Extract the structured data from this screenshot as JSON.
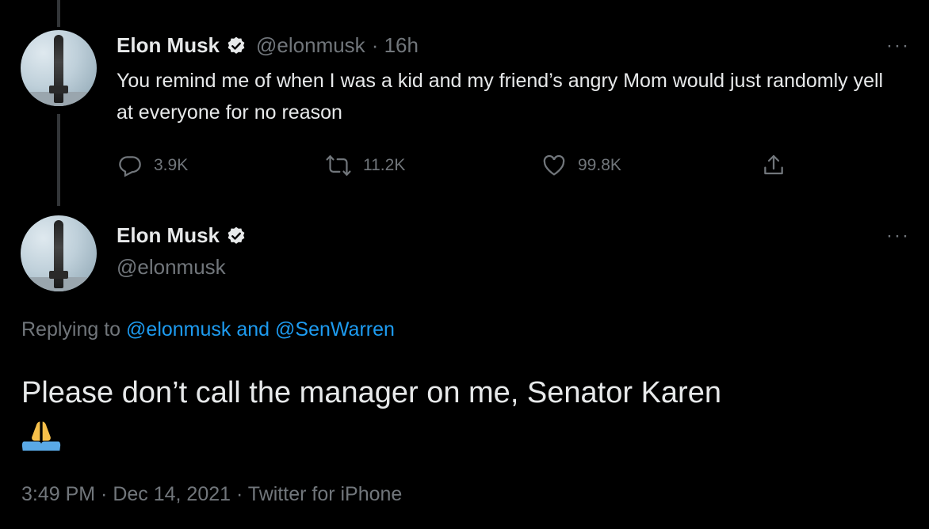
{
  "tweet1": {
    "name": "Elon Musk",
    "handle": "@elonmusk",
    "time": "· 16h",
    "text": "You remind me of when I was a kid and my friend’s angry Mom would just randomly yell at everyone for no reason",
    "reply_count": "3.9K",
    "retweet_count": "11.2K",
    "like_count": "99.8K",
    "more": "···"
  },
  "tweet2": {
    "name": "Elon Musk",
    "handle": "@elonmusk",
    "more": "···",
    "replying_prefix": "Replying to ",
    "reply_handle_1": "@elonmusk",
    "reply_and": " and ",
    "reply_handle_2": "@SenWarren",
    "text": "Please don’t call the manager on me, Senator Karen",
    "timestamp": "3:49 PM · Dec 14, 2021 · Twitter for iPhone"
  },
  "colors": {
    "background": "#000000",
    "text": "#e7e9ea",
    "muted": "#71767b",
    "accent": "#1d9bf0"
  },
  "icons": [
    "verified-badge-icon",
    "reply-icon",
    "retweet-icon",
    "like-icon",
    "share-icon",
    "more-icon",
    "folded-hands-emoji"
  ]
}
